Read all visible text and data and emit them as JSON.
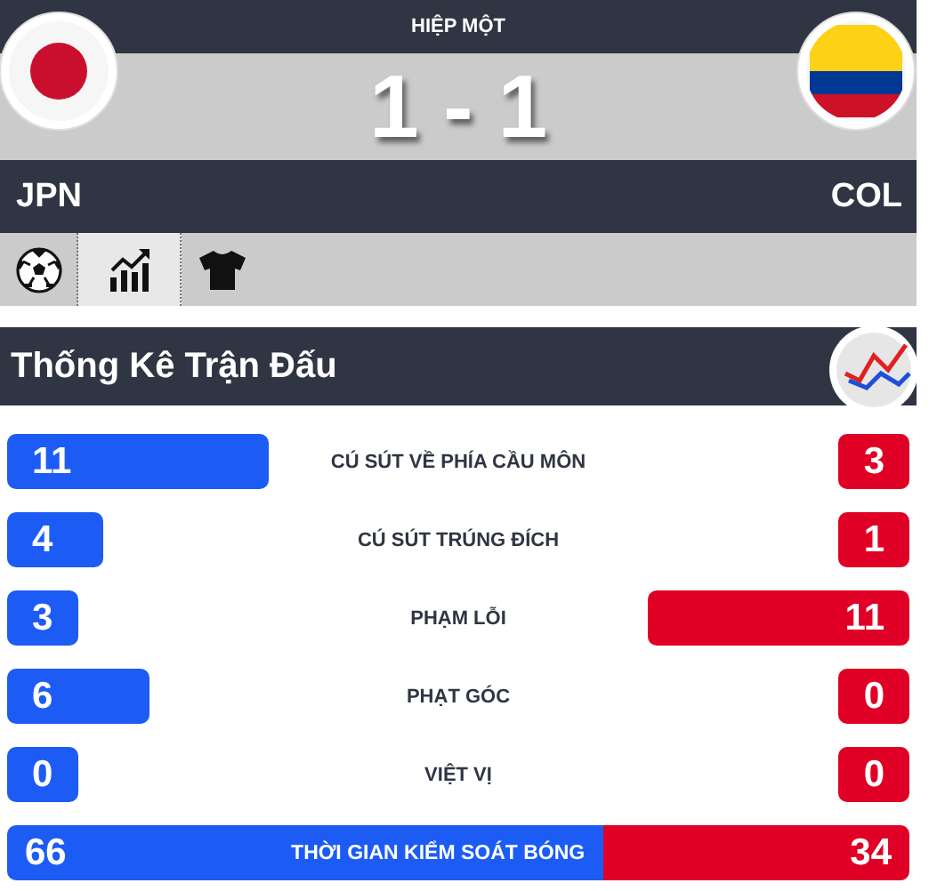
{
  "match": {
    "period": "HIỆP MỘT",
    "score": "1 - 1",
    "home": {
      "code": "JPN"
    },
    "away": {
      "code": "COL"
    }
  },
  "tabs": [
    {
      "kind": "ball",
      "selected": false
    },
    {
      "kind": "chart",
      "selected": true
    },
    {
      "kind": "shirt",
      "selected": false
    }
  ],
  "stats": {
    "title": "Thống Kê Trận Đấu",
    "rows": [
      {
        "kind": "bars",
        "label": "CÚ SÚT VỀ PHÍA CẦU MÔN",
        "home": "11",
        "away": "3"
      },
      {
        "kind": "bars",
        "label": "CÚ SÚT TRÚNG ĐÍCH",
        "home": "4",
        "away": "1"
      },
      {
        "kind": "bars",
        "label": "PHẠM LỖI",
        "home": "3",
        "away": "11"
      },
      {
        "kind": "bars",
        "label": "PHẠT GÓC",
        "home": "6",
        "away": "0"
      },
      {
        "kind": "bars",
        "label": "VIỆT VỊ",
        "home": "0",
        "away": "0"
      },
      {
        "kind": "split",
        "label": "THỜI GIAN KIỂM SOÁT BÓNG",
        "home": "66",
        "away": "34"
      }
    ]
  }
}
